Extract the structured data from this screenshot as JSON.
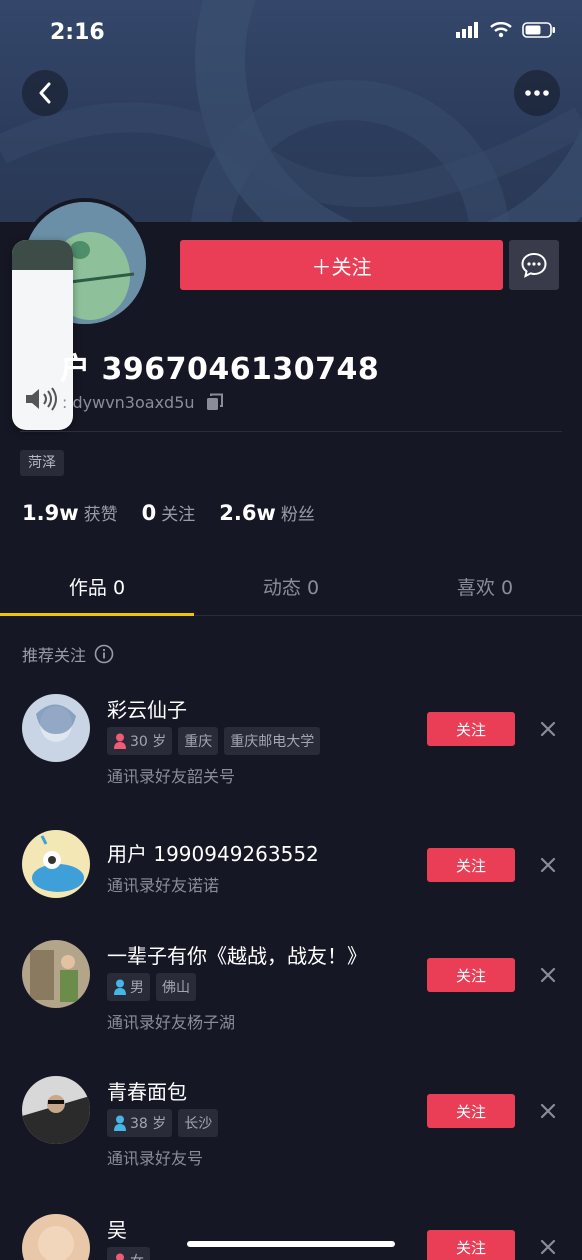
{
  "status_bar": {
    "time": "2:16"
  },
  "header": {
    "back_icon": "chevron-left-icon",
    "more_icon": "more-dots-icon"
  },
  "profile": {
    "follow_button_label": "＋关注",
    "message_icon": "chat-bubble-icon",
    "username": "户 3967046130748",
    "douyin_id": ": dywvn3oaxd5u",
    "copy_icon": "copy-icon",
    "location": "菏泽",
    "stats": [
      {
        "value": "1.9w",
        "label": "获赞"
      },
      {
        "value": "0",
        "label": "关注"
      },
      {
        "value": "2.6w",
        "label": "粉丝"
      }
    ]
  },
  "volume": {
    "level": 0.84,
    "icon": "speaker-icon"
  },
  "tabs": [
    {
      "label": "作品 0",
      "active": true
    },
    {
      "label": "动态 0",
      "active": false
    },
    {
      "label": "喜欢 0",
      "active": false
    }
  ],
  "recommend": {
    "title": "推荐关注",
    "info_icon": "info-icon",
    "follow_label": "关注",
    "items": [
      {
        "name": "彩云仙子",
        "tags": [
          {
            "text": "30 岁",
            "gender": "female"
          },
          {
            "text": "重庆"
          },
          {
            "text": "重庆邮电大学"
          }
        ],
        "subtitle": "通讯录好友韶关号"
      },
      {
        "name": "用户 1990949263552",
        "tags": [],
        "subtitle": "通讯录好友诺诺"
      },
      {
        "name": "一辈子有你《越战，战友！》",
        "tags": [
          {
            "text": "男",
            "gender": "male"
          },
          {
            "text": "佛山"
          }
        ],
        "subtitle": "通讯录好友杨子湖"
      },
      {
        "name": "青春面包",
        "tags": [
          {
            "text": "38 岁",
            "gender": "male"
          },
          {
            "text": "长沙"
          }
        ],
        "subtitle": "通讯录好友号"
      },
      {
        "name": "吴",
        "tags": [
          {
            "text": "女",
            "gender": "female"
          }
        ],
        "subtitle": ""
      }
    ]
  },
  "colors": {
    "accent": "#ea3e56",
    "tab_indicator": "#f5c400",
    "background": "#161724"
  }
}
